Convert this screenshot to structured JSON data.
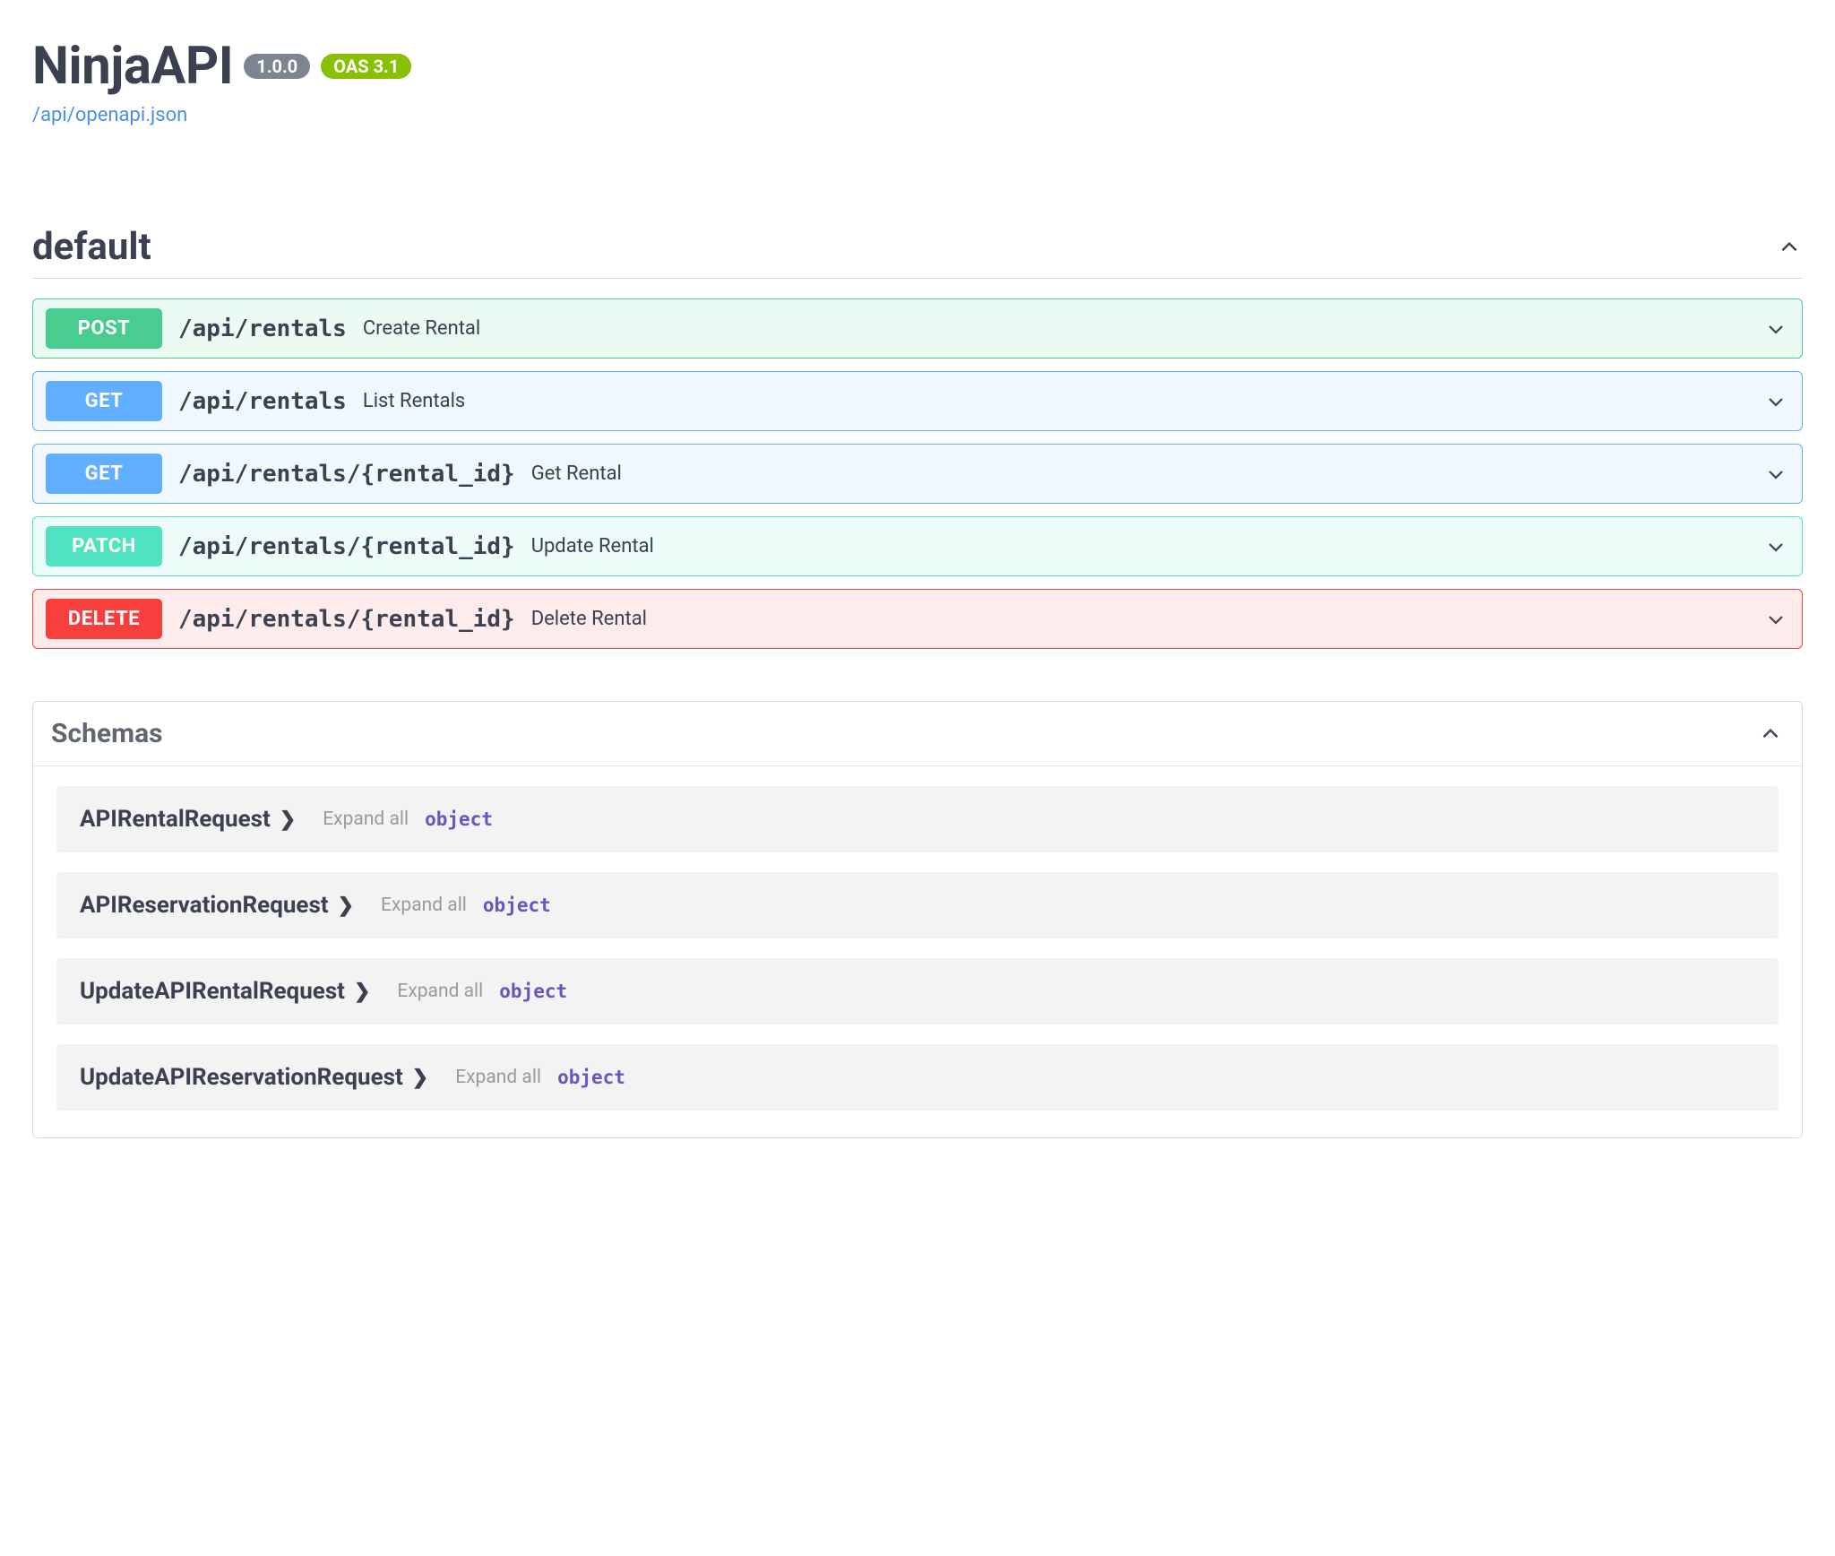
{
  "header": {
    "title": "NinjaAPI",
    "version": "1.0.0",
    "oas": "OAS 3.1",
    "spec_link": "/api/openapi.json"
  },
  "section": {
    "title": "default",
    "ops": [
      {
        "method": "POST",
        "path": "/api/rentals",
        "summary": "Create Rental"
      },
      {
        "method": "GET",
        "path": "/api/rentals",
        "summary": "List Rentals"
      },
      {
        "method": "GET",
        "path": "/api/rentals/{rental_id}",
        "summary": "Get Rental"
      },
      {
        "method": "PATCH",
        "path": "/api/rentals/{rental_id}",
        "summary": "Update Rental"
      },
      {
        "method": "DELETE",
        "path": "/api/rentals/{rental_id}",
        "summary": "Delete Rental"
      }
    ]
  },
  "schemas": {
    "title": "Schemas",
    "expand_label": "Expand all",
    "type_label": "object",
    "items": [
      {
        "name": "APIRentalRequest"
      },
      {
        "name": "APIReservationRequest"
      },
      {
        "name": "UpdateAPIRentalRequest"
      },
      {
        "name": "UpdateAPIReservationRequest"
      }
    ]
  }
}
